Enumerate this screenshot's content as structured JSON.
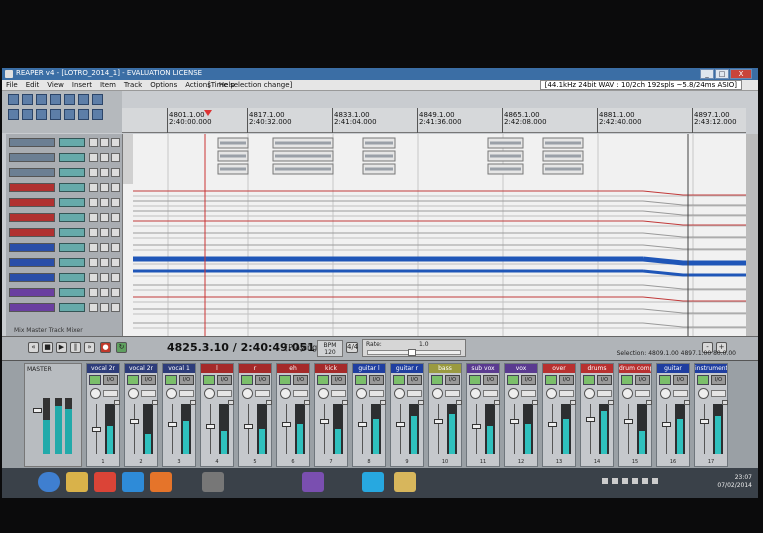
{
  "window": {
    "title": "REAPER v4 - [LOTRO_2014_1] - EVALUATION LICENSE",
    "controls": [
      "_",
      "□",
      "X"
    ]
  },
  "menu": {
    "items": [
      "File",
      "Edit",
      "View",
      "Insert",
      "Item",
      "Track",
      "Options",
      "Actions",
      "Help"
    ],
    "undo_hint": "[Time selection change]",
    "audio_status": "[44.1kHz 24bit WAV : 10/2ch 192spls ~5.8/24ms ASIO]"
  },
  "ruler": {
    "marks": [
      {
        "bar": "4801.1.00",
        "time": "2:40:00.000"
      },
      {
        "bar": "4817.1.00",
        "time": "2:40:32.000"
      },
      {
        "bar": "4833.1.00",
        "time": "2:41:04.000"
      },
      {
        "bar": "4849.1.00",
        "time": "2:41:36.000"
      },
      {
        "bar": "4865.1.00",
        "time": "2:42:08.000"
      },
      {
        "bar": "4881.1.00",
        "time": "2:42:40.000"
      },
      {
        "bar": "4897.1.00",
        "time": "2:43:12.000"
      }
    ]
  },
  "tracks": [
    {
      "name": "vocal 2r",
      "color": "#6c7f93"
    },
    {
      "name": "vocal 2r",
      "color": "#6c7f93"
    },
    {
      "name": "vocal 1",
      "color": "#6c7f93"
    },
    {
      "name": "l",
      "color": "#b03030"
    },
    {
      "name": "r",
      "color": "#b03030"
    },
    {
      "name": "eh",
      "color": "#b03030"
    },
    {
      "name": "kick",
      "color": "#b03030"
    },
    {
      "name": "guitar l",
      "color": "#2a4ea8"
    },
    {
      "name": "guitar r",
      "color": "#2a4ea8"
    },
    {
      "name": "bass",
      "color": "#2a4ea8"
    },
    {
      "name": "sub vox",
      "color": "#6a3fa0"
    },
    {
      "name": "vox",
      "color": "#6a3fa0"
    }
  ],
  "tcp_footer": "Mix  Master  Track Mixer",
  "transport": {
    "position": "4825.3.10 / 2:40:49.051",
    "state": "[Playing]",
    "bpm_label": "BPM",
    "bpm_value": "120",
    "sig": "4/4",
    "rate_label": "Rate:",
    "rate_value": "1.0",
    "selection": "Selection:  4809.1.00     4897.1.00     80.0.00"
  },
  "mixer": {
    "master_label": "MASTER",
    "strips": [
      {
        "name": "vocal 2r",
        "color": "#2d3c7a",
        "num": "1",
        "meter": 0.55,
        "fader": 0.45
      },
      {
        "name": "vocal 2r",
        "color": "#2d3c7a",
        "num": "2",
        "meter": 0.4,
        "fader": 0.3
      },
      {
        "name": "vocal 1",
        "color": "#2d3c7a",
        "num": "3",
        "meter": 0.65,
        "fader": 0.35
      },
      {
        "name": "l",
        "color": "#a52a2a",
        "num": "4",
        "meter": 0.45,
        "fader": 0.4
      },
      {
        "name": "r",
        "color": "#a52a2a",
        "num": "5",
        "meter": 0.5,
        "fader": 0.4
      },
      {
        "name": "eh",
        "color": "#a52a2a",
        "num": "6",
        "meter": 0.6,
        "fader": 0.35
      },
      {
        "name": "kick",
        "color": "#a52a2a",
        "num": "7",
        "meter": 0.5,
        "fader": 0.3
      },
      {
        "name": "guitar l",
        "color": "#1f3ea0",
        "num": "8",
        "meter": 0.7,
        "fader": 0.35
      },
      {
        "name": "guitar r",
        "color": "#1f3ea0",
        "num": "9",
        "meter": 0.75,
        "fader": 0.35
      },
      {
        "name": "bass",
        "color": "#9a9a40",
        "num": "10",
        "meter": 0.8,
        "fader": 0.3
      },
      {
        "name": "sub vox",
        "color": "#5a3a90",
        "num": "11",
        "meter": 0.55,
        "fader": 0.4
      },
      {
        "name": "vox",
        "color": "#5a3a90",
        "num": "12",
        "meter": 0.6,
        "fader": 0.3
      },
      {
        "name": "over",
        "color": "#b83030",
        "num": "13",
        "meter": 0.7,
        "fader": 0.35
      },
      {
        "name": "drums",
        "color": "#b83030",
        "num": "14",
        "meter": 0.85,
        "fader": 0.25
      },
      {
        "name": "drum comp",
        "color": "#b83030",
        "num": "15",
        "meter": 0.45,
        "fader": 0.3
      },
      {
        "name": "guitar",
        "color": "#1f3ea0",
        "num": "16",
        "meter": 0.7,
        "fader": 0.35
      },
      {
        "name": "instruments",
        "color": "#1f3ea0",
        "num": "17",
        "meter": 0.75,
        "fader": 0.3
      }
    ]
  },
  "taskbar": {
    "apps": [
      "start-orb",
      "explorer",
      "chrome",
      "ie",
      "firefox",
      "reaper",
      "media",
      "skype",
      "folder"
    ],
    "time": "23:07",
    "date": "07/02/2014"
  },
  "colors": {
    "waveform": "#9aa0a8",
    "blue_wave": "#1f56b8",
    "red_line": "#c13a3a",
    "meter": "#2fc0bd"
  }
}
